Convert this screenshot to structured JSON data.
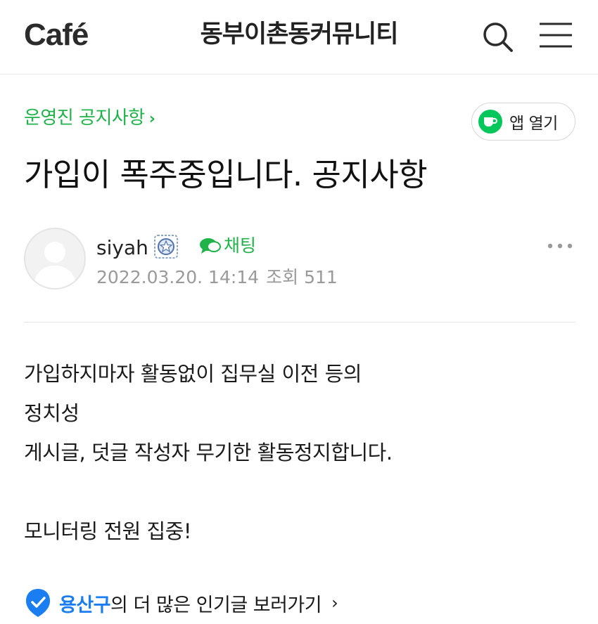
{
  "header": {
    "logo": "Café",
    "cafe_name": "동부이촌동커뮤니티",
    "search_icon": "search-icon",
    "menu_icon": "hamburger-menu-icon"
  },
  "board": {
    "label": "운영진 공지사항",
    "chevron": "›"
  },
  "app_open": {
    "label": "앱 열기",
    "icon": "coffee-cup-icon"
  },
  "post": {
    "title": "가입이 폭주중입니다. 공지사항",
    "author": "siyah",
    "author_grade_icon": "manager-badge-icon",
    "chat_label": "채팅",
    "date": "2022.03.20. 14:14",
    "views_label": "조회",
    "views": "511",
    "body_lines": [
      "가입하지마자 활동없이 집무실 이전 등의",
      "정치성",
      "게시글, 덧글 작성자 무기한 활동정지합니다.",
      "모니터링 전원 집중!"
    ]
  },
  "popular": {
    "region": "용산구",
    "text": "의 더 많은 인기글 보러가기",
    "chevron": "›"
  },
  "colors": {
    "accent_green": "#1fb349",
    "app_icon_green": "#03c75a",
    "region_blue": "#1a7ef2",
    "meta_gray": "#9a9a9a"
  }
}
